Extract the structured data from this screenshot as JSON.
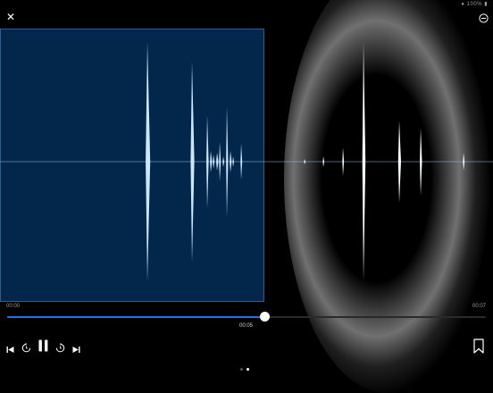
{
  "status_bar": {
    "text": "● 100% ▮"
  },
  "toolbar": {
    "close_icon": "close-icon",
    "more_icon": "more-circle-icon"
  },
  "waveform": {
    "selection_fraction": 0.533,
    "colors": {
      "selected": "#02274b",
      "selected_wave": "#cde6ff",
      "wave": "#ffffff"
    }
  },
  "playback": {
    "start_time": "00:00",
    "end_time": "00:07",
    "current_time": "00:05",
    "progress_fraction": 0.538,
    "accent": "#1e73e8"
  },
  "controls": {
    "icons": [
      "skip-back-icon",
      "rewind-icon",
      "pause-icon",
      "forward-icon",
      "skip-forward-icon",
      "bookmark-icon"
    ]
  },
  "pager": {
    "count": 2,
    "active_index": 1
  }
}
